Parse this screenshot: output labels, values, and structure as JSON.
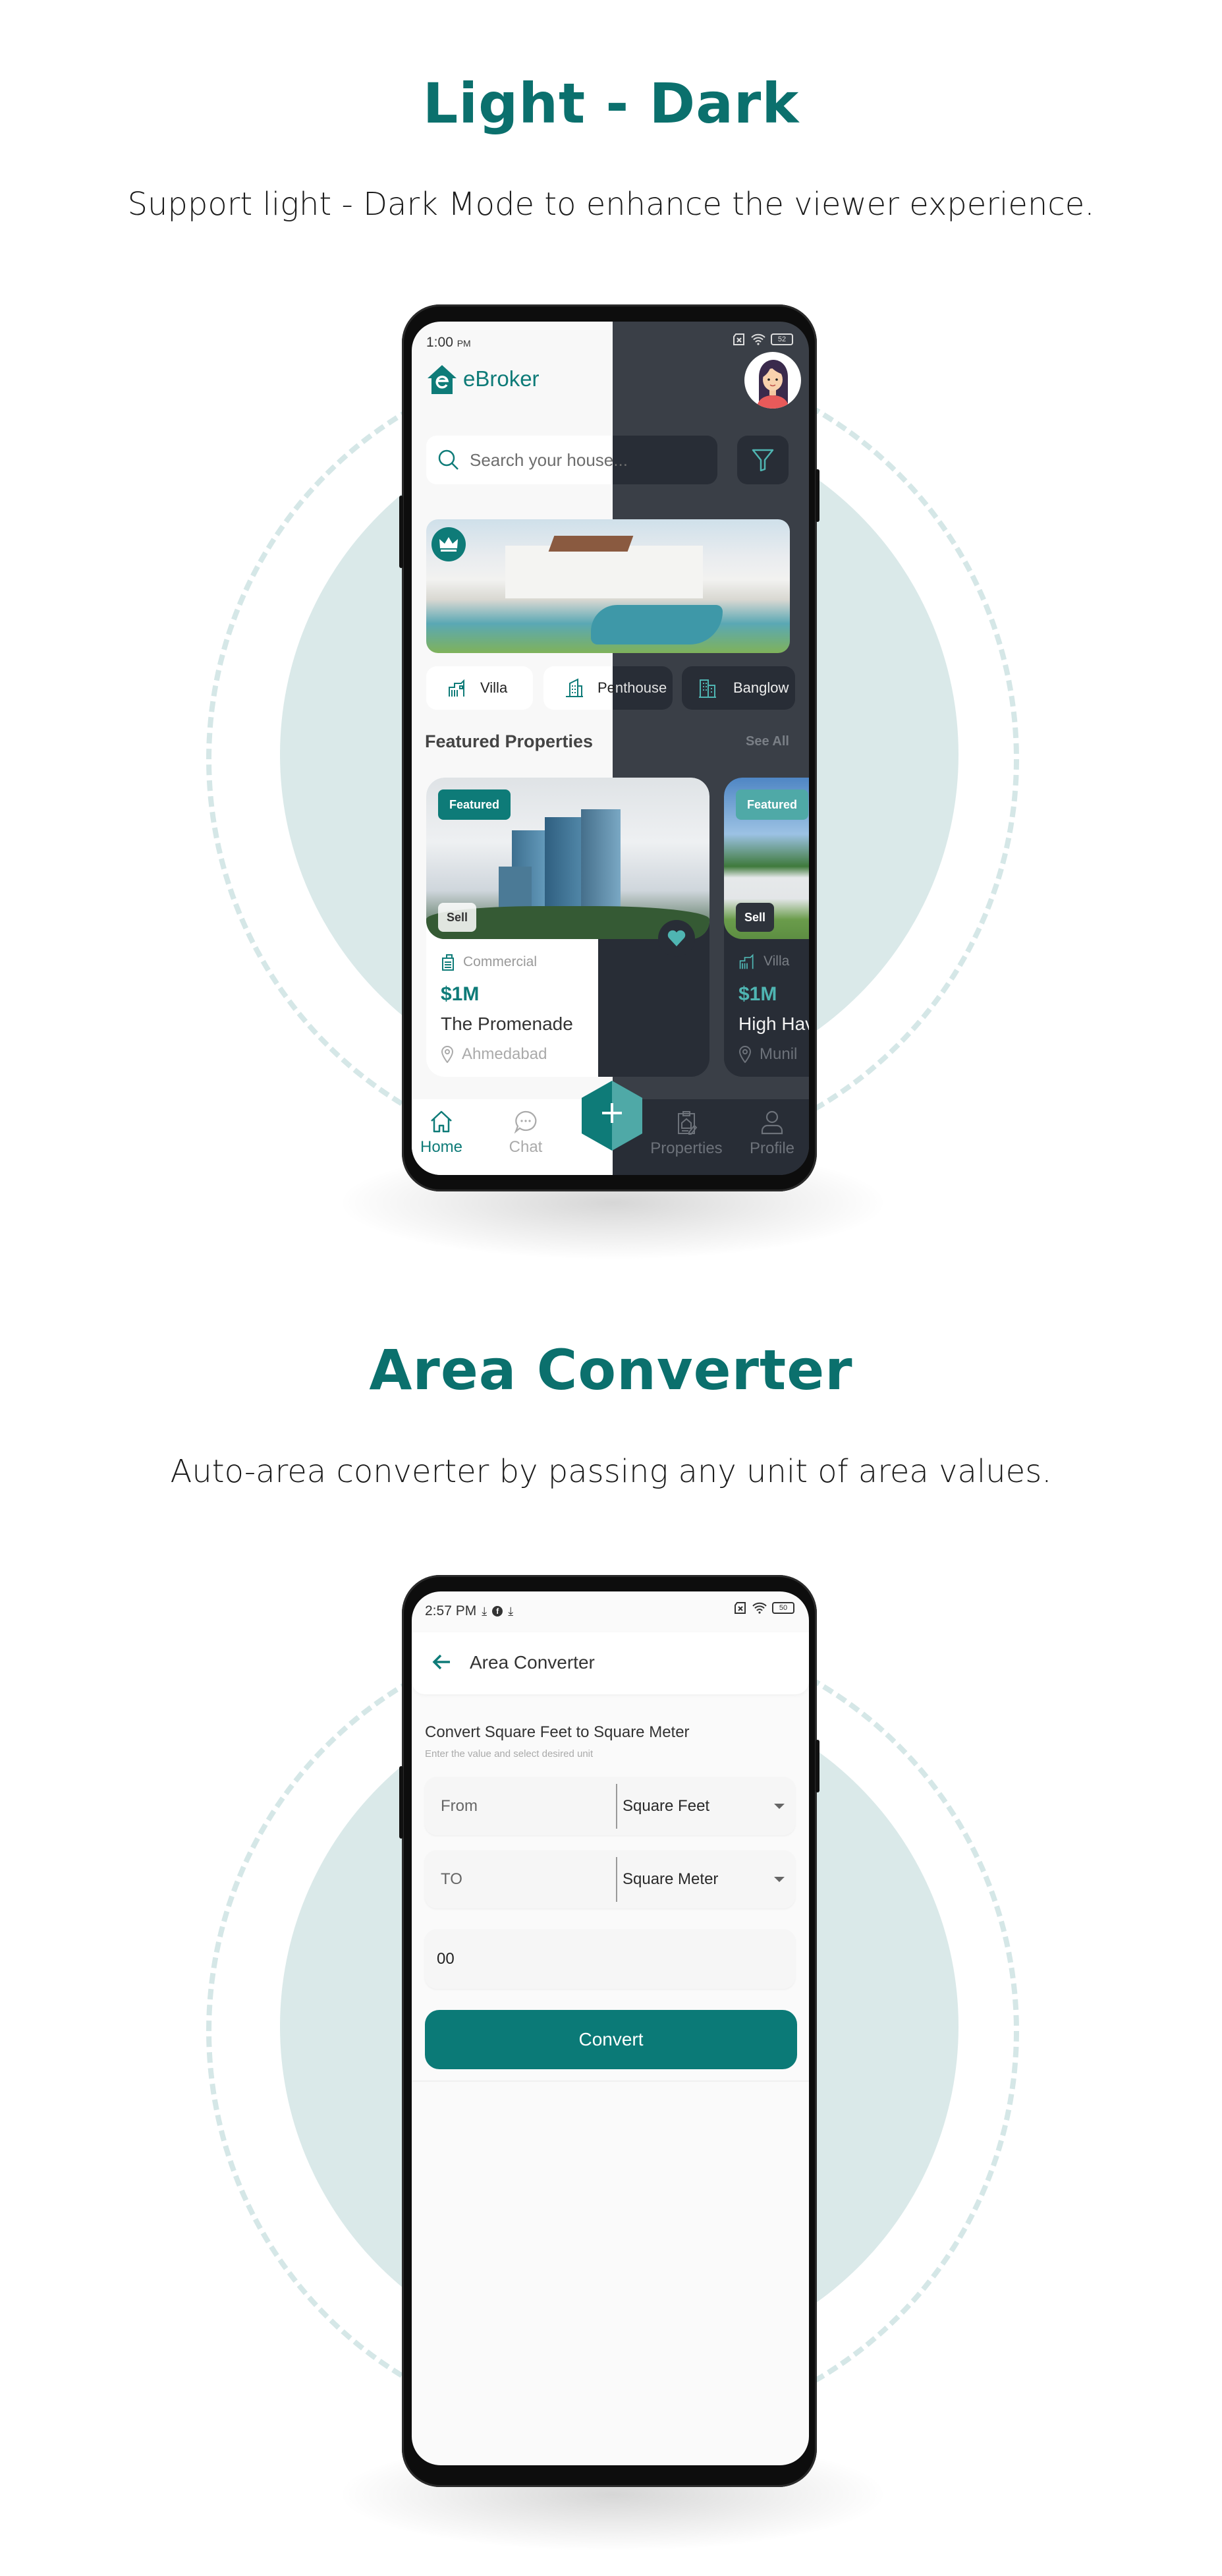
{
  "colors": {
    "accent": "#0e7b78",
    "accent_light": "#4fa9a7",
    "dark_bg": "#3a3f47",
    "dark_surface": "#282d36",
    "light_bg": "#f8f8f8",
    "circle": "#dae9e9"
  },
  "section1": {
    "title": "Light - Dark",
    "subtitle": "Support light - Dark Mode to enhance the viewer experience.",
    "phone": {
      "status_time": "1:00",
      "status_ampm": "PM",
      "battery": "52",
      "status_icons": [
        "sim-off-icon",
        "wifi-icon",
        "battery-icon"
      ],
      "app_name": "eBroker",
      "search_placeholder": "Search your house...",
      "categories": [
        {
          "label": "Villa",
          "icon": "villa-icon"
        },
        {
          "label": "Penthouse",
          "icon": "penthouse-icon"
        },
        {
          "label": "Banglow",
          "icon": "banglow-icon"
        }
      ],
      "featured_title": "Featured Properties",
      "see_all": "See All",
      "cards": [
        {
          "badge": "Featured",
          "tag": "Sell",
          "category": "Commercial",
          "price": "$1M",
          "name": "The Promenade",
          "location": "Ahmedabad"
        },
        {
          "badge": "Featured",
          "tag": "Sell",
          "category": "Villa",
          "price": "$1M",
          "name": "High Hav",
          "location": "Munil"
        }
      ],
      "nav": [
        {
          "label": "Home",
          "icon": "home-icon",
          "active": true
        },
        {
          "label": "Chat",
          "icon": "chat-icon",
          "active": false
        },
        {
          "label": "Properties",
          "icon": "properties-icon",
          "active": false
        },
        {
          "label": "Profile",
          "icon": "profile-icon",
          "active": false
        }
      ],
      "fab_symbol": "+"
    }
  },
  "section2": {
    "title": "Area Converter",
    "subtitle": "Auto-area converter by passing any unit of area values.",
    "phone": {
      "status_time": "2:57 PM",
      "battery": "50",
      "header_title": "Area Converter",
      "heading": "Convert Square Feet to  Square Meter",
      "hint": "Enter the value and select desired unit",
      "from_placeholder": "From",
      "from_unit": "Square Feet",
      "to_placeholder": "TO",
      "to_unit": "Square Meter",
      "result_value": "00",
      "convert_label": "Convert"
    }
  }
}
